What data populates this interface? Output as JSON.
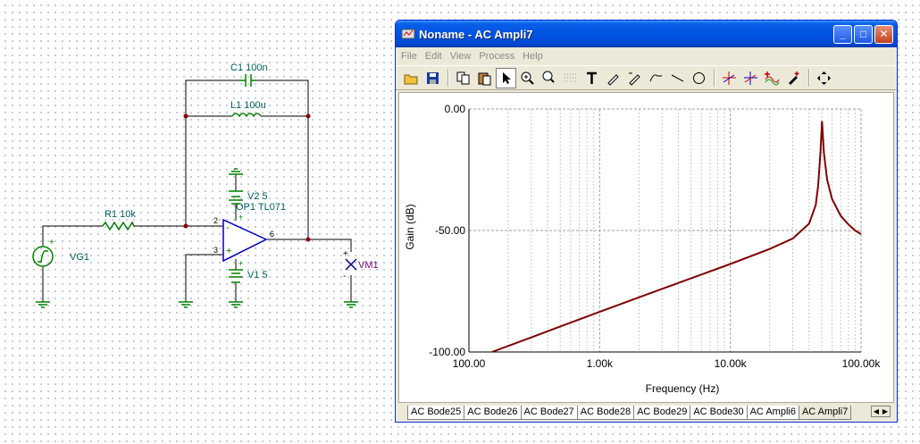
{
  "schematic": {
    "c1_label": "C1 100n",
    "l1_label": "L1 100u",
    "r1_label": "R1 10k",
    "vg1_label": "VG1",
    "v2_label": "V2 5",
    "op1_label": "OP1 TL071",
    "v1_label": "V1 5",
    "vm1_label": "VM1",
    "pin2": "2",
    "pin3": "3",
    "pin6": "6",
    "plus": "+",
    "minus": "-",
    "colors": {
      "wire": "#000000",
      "component": "#008000",
      "label": "#006060",
      "opamp": "#0000c0",
      "meter": "#00008b",
      "vm_label": "#800080"
    }
  },
  "window": {
    "title": "Noname - AC Ampli7",
    "controls": {
      "minimize": "_",
      "maximize": "□",
      "close": "✕"
    }
  },
  "menu": [
    "File",
    "Edit",
    "View",
    "Process",
    "Help"
  ],
  "toolbar_icons": [
    "open-icon",
    "save-icon",
    "copy-icon",
    "paste-icon",
    "pointer-icon",
    "zoom-in-icon",
    "zoom-100-icon",
    "grid-icon",
    "text-icon",
    "pen-icon",
    "pen2-icon",
    "step-icon",
    "line-icon",
    "circle-icon",
    "cursor-a-icon",
    "cursor-b-icon",
    "add-curve-icon",
    "pick-color-icon",
    "arrows-icon"
  ],
  "tabs": [
    "AC Bode25",
    "AC Bode26",
    "AC Bode27",
    "AC Bode28",
    "AC Bode29",
    "AC Bode30",
    "AC Ampli6",
    "AC Ampli7"
  ],
  "active_tab": 7,
  "chart_data": {
    "type": "line",
    "xscale": "log",
    "xlim": [
      100,
      100000
    ],
    "ylim": [
      -100,
      0
    ],
    "xlabel": "Frequency (Hz)",
    "ylabel": "Gain (dB)",
    "xticks": [
      100,
      1000,
      10000,
      100000
    ],
    "xtick_labels": [
      "100.00",
      "1.00k",
      "10.00k",
      "100.00k"
    ],
    "yticks": [
      0,
      -50,
      -100
    ],
    "ytick_labels": [
      "0.00",
      "-50.00",
      "-100.00"
    ],
    "grid": true,
    "series": [
      {
        "color": "#800000",
        "x": [
          150,
          200,
          300,
          500,
          1000,
          2000,
          5000,
          10000,
          20000,
          30000,
          40000,
          45000,
          47000,
          48000,
          49000,
          50300,
          52000,
          55000,
          60000,
          70000,
          80000,
          90000,
          100000
        ],
        "y": [
          -100,
          -97.5,
          -94,
          -89.5,
          -83.5,
          -77.5,
          -69.7,
          -63.8,
          -57.6,
          -53.3,
          -47.2,
          -39.5,
          -31.5,
          -24,
          -17,
          -5,
          -18,
          -29,
          -37,
          -44,
          -47.5,
          -50,
          -51.5
        ]
      }
    ]
  }
}
